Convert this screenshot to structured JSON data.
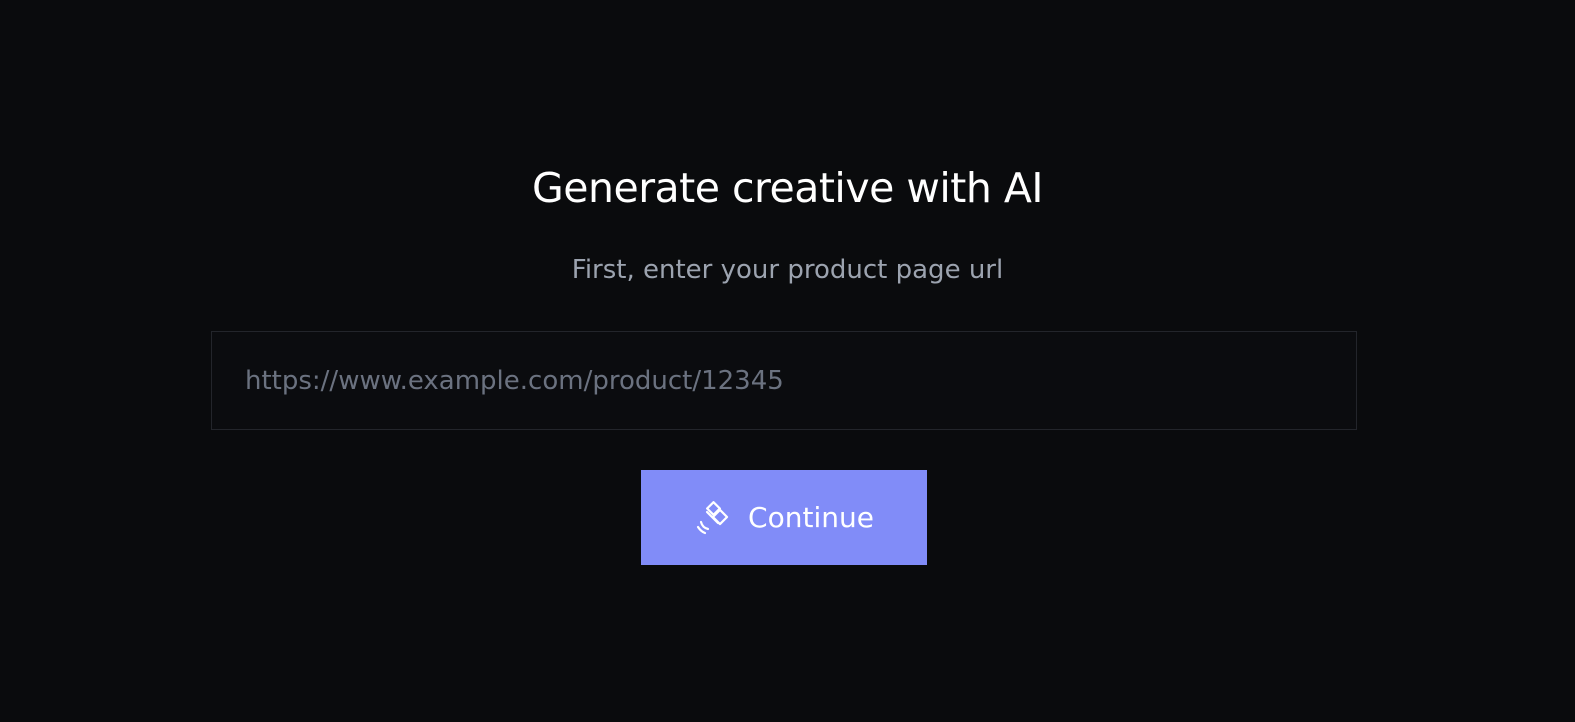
{
  "header": {
    "title": "Generate creative with AI",
    "subtitle": "First, enter your product page url"
  },
  "form": {
    "url_input": {
      "value": "",
      "placeholder": "https://www.example.com/product/12345"
    },
    "continue_button": {
      "label": "Continue",
      "icon": "satellite-icon"
    }
  },
  "colors": {
    "background": "#0a0b0d",
    "accent": "#818cf8",
    "title": "#ffffff",
    "subtitle": "#9ca3af",
    "placeholder": "#6b7280"
  }
}
